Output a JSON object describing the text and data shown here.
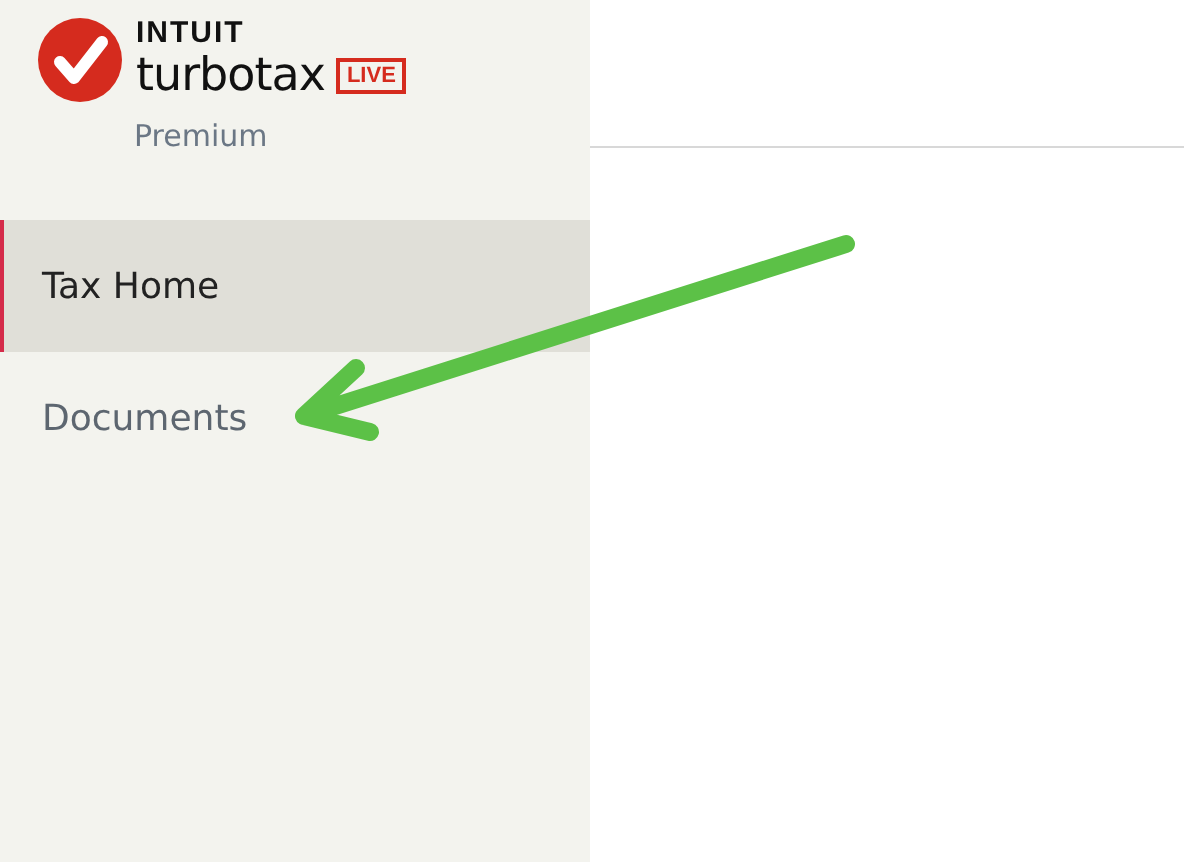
{
  "brand": {
    "company": "INTUIT",
    "product": "turbotax",
    "badge": "LIVE",
    "edition": "Premium"
  },
  "sidebar": {
    "items": [
      {
        "label": "Tax Home",
        "selected": true
      },
      {
        "label": "Documents",
        "selected": false
      }
    ]
  }
}
